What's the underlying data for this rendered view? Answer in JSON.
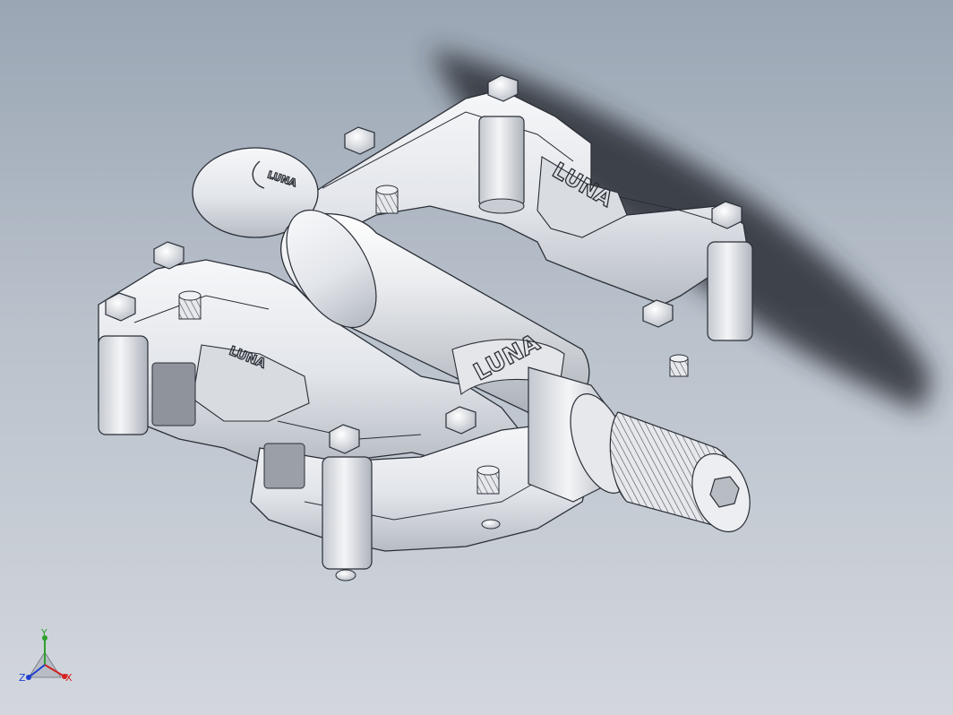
{
  "model": {
    "name": "",
    "brand_marks": [
      "LUNA",
      "LUNA",
      "LUNA",
      "LUNA"
    ]
  },
  "triad": {
    "labels": {
      "x": "X",
      "y": "Y",
      "z": "Z"
    },
    "colors": {
      "x": "#d42222",
      "y": "#2ca02c",
      "z": "#1f3fd1"
    }
  },
  "colors": {
    "background_top": "#9aa6b4",
    "background_bottom": "#d3d7dd",
    "metal_light": "#f2f3f5",
    "metal_mid": "#d7dae0",
    "metal_dark": "#a8adb6",
    "edge": "#2a2e36",
    "shadow": "#2c2f34"
  }
}
